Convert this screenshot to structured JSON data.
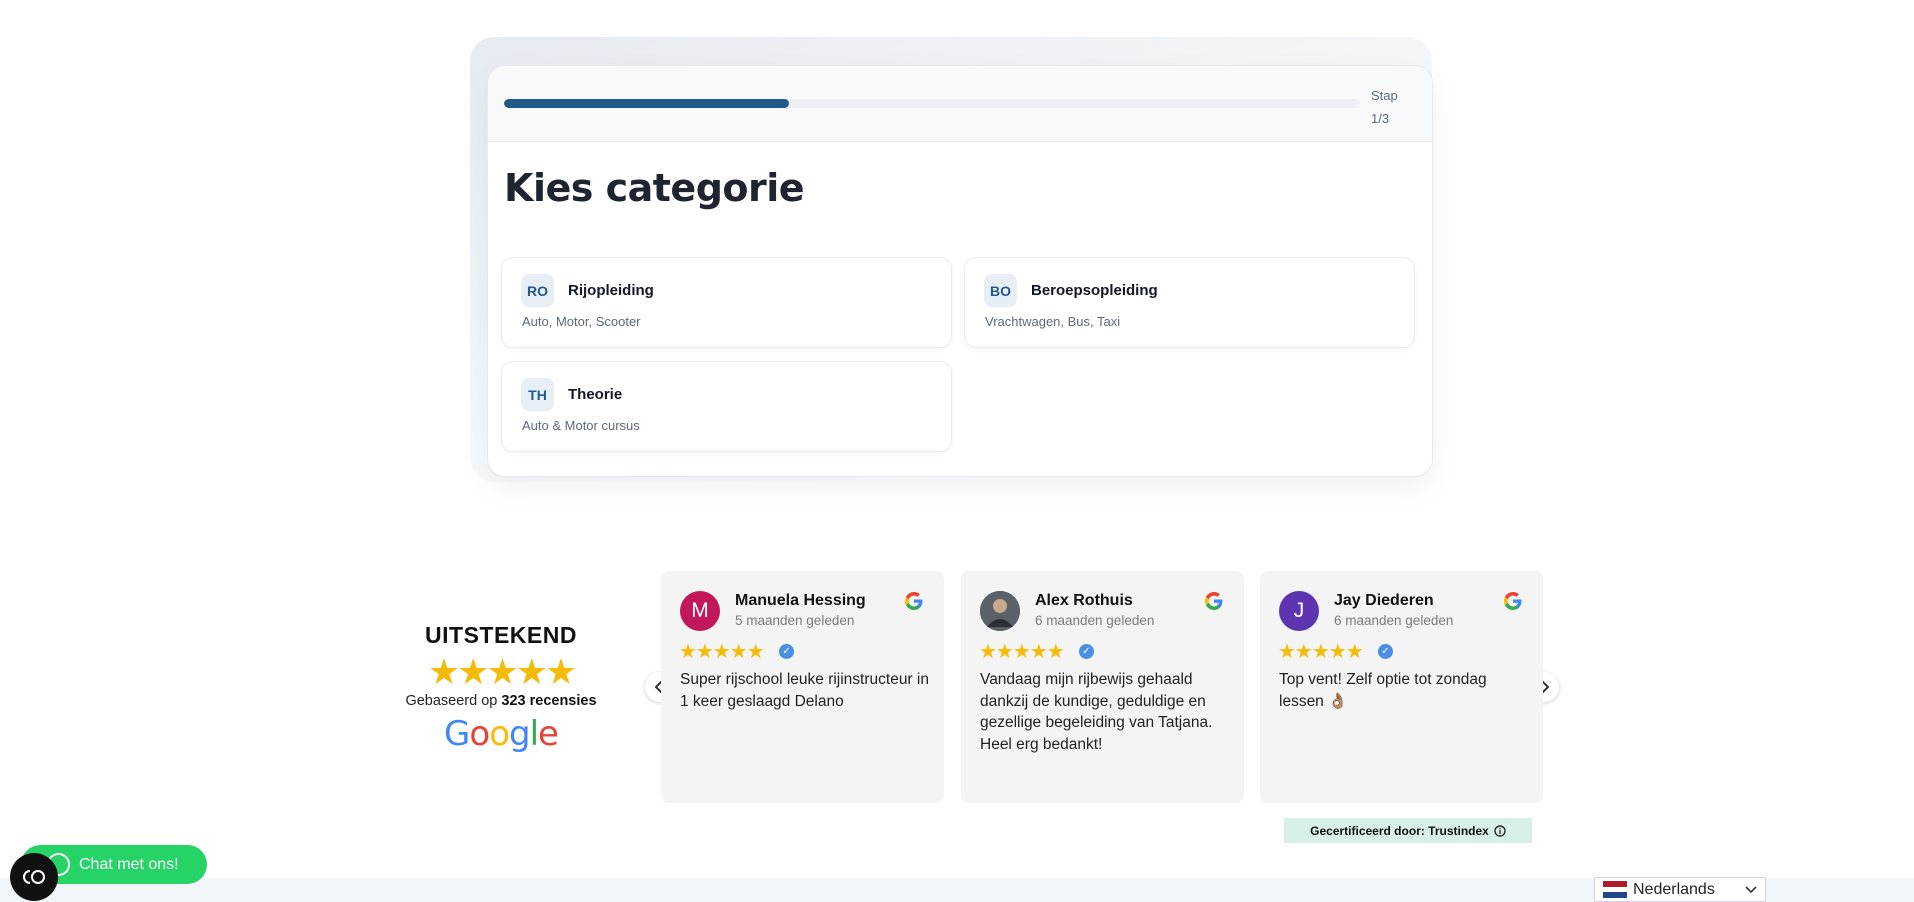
{
  "wizard": {
    "step_label": "Stap",
    "step_value": "1/3",
    "progress": 0.333,
    "title": "Kies categorie",
    "options": [
      {
        "code": "RO",
        "title": "Rijopleiding",
        "subtitle": "Auto, Motor, Scooter"
      },
      {
        "code": "BO",
        "title": "Beroepsopleiding",
        "subtitle": "Vrachtwagen, Bus, Taxi"
      },
      {
        "code": "TH",
        "title": "Theorie",
        "subtitle": "Auto & Motor cursus"
      }
    ]
  },
  "reviews": {
    "rating_word": "UITSTEKEND",
    "stars": "★★★★★",
    "based_on_prefix": "Gebaseerd op ",
    "based_on_count": "323 recensies",
    "items": [
      {
        "initial": "M",
        "avatar_color": "#c2185b",
        "name": "Manuela Hessing",
        "date": "5 maanden geleden",
        "stars": "★★★★★",
        "text": "Super rijschool leuke rijinstructeur in 1 keer geslaagd Delano"
      },
      {
        "initial": "",
        "avatar_color": "#4a4f55",
        "name": "Alex Rothuis",
        "date": "6 maanden geleden",
        "stars": "★★★★★",
        "text": "Vandaag mijn rijbewijs gehaald dankzij de kundige, geduldige en gezellige begeleiding van Tatjana. Heel erg bedankt!"
      },
      {
        "initial": "J",
        "avatar_color": "#5e35b1",
        "name": "Jay Diederen",
        "date": "6 maanden geleden",
        "stars": "★★★★★",
        "text": "Top vent! Zelf optie tot zondag lessen 👌🏽"
      }
    ],
    "certified": "Gecertificeerd door: Trustindex"
  },
  "chat": {
    "label": "Chat met ons!"
  },
  "language": {
    "selected": "Nederlands"
  },
  "colors": {
    "accent": "#1f5a8a",
    "star": "#f6bb06",
    "whatsapp": "#25d366"
  }
}
